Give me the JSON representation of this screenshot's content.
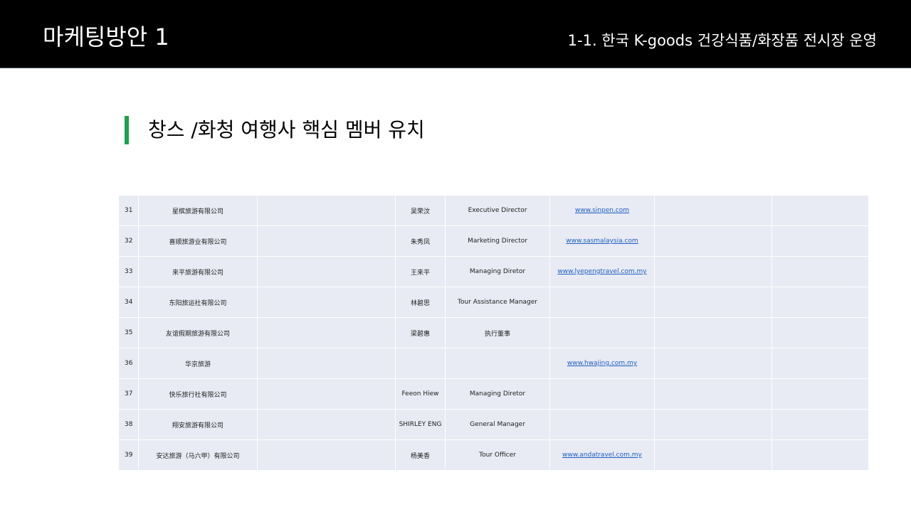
{
  "header": {
    "title": "마케팅방안 1",
    "subtitle": "1-1. 한국 K-goods 건강식품/화장품 전시장 운영"
  },
  "section": {
    "title": "창스 /화청 여행사 핵심 멤버 유치"
  },
  "table": {
    "rows": [
      {
        "no": "31",
        "company": "星槟旅游有限公司",
        "extra": "",
        "name": "吴荣汶",
        "title": "Executive Director",
        "website": "www.sinpen.com",
        "col7": "",
        "col8": ""
      },
      {
        "no": "32",
        "company": "喜顺旅游业有限公司",
        "extra": "",
        "name": "朱秀凤",
        "title": "Marketing Director",
        "website": "www.sasmalaysia.com",
        "col7": "",
        "col8": ""
      },
      {
        "no": "33",
        "company": "来平旅游有限公司",
        "extra": "",
        "name": "王来平",
        "title": "Managing Diretor",
        "website": "www.lyepengtravel.com.my",
        "col7": "",
        "col8": ""
      },
      {
        "no": "34",
        "company": "东阳旅运社有限公司",
        "extra": "",
        "name": "林碧思",
        "title": "Tour Assistance Manager",
        "website": "",
        "col7": "",
        "col8": ""
      },
      {
        "no": "35",
        "company": "友谊假期旅游有限公司",
        "extra": "",
        "name": "梁碧惠",
        "title": "执行董事",
        "website": "",
        "col7": "",
        "col8": ""
      },
      {
        "no": "36",
        "company": "华京旅游",
        "extra": "",
        "name": "",
        "title": "",
        "website": "www.hwajing.com.my",
        "col7": "",
        "col8": ""
      },
      {
        "no": "37",
        "company": "快乐旅行社有限公司",
        "extra": "",
        "name": "Feeon Hiew",
        "title": "Managing Diretor",
        "website": "",
        "col7": "",
        "col8": ""
      },
      {
        "no": "38",
        "company": "翔安旅游有限公司",
        "extra": "",
        "name": "SHIRLEY ENG",
        "title": "General Manager",
        "website": "",
        "col7": "",
        "col8": ""
      },
      {
        "no": "39",
        "company": "安达旅游（马六甲）有限公司",
        "extra": "",
        "name": "杨美香",
        "title": "Tour Officer",
        "website": "www.andatravel.com.my",
        "col7": "",
        "col8": ""
      }
    ]
  },
  "colors": {
    "header_bg": "#000000",
    "accent": "#1aa34a",
    "table_cell_bg": "#e8eaf4",
    "link": "#1f5fbf"
  }
}
